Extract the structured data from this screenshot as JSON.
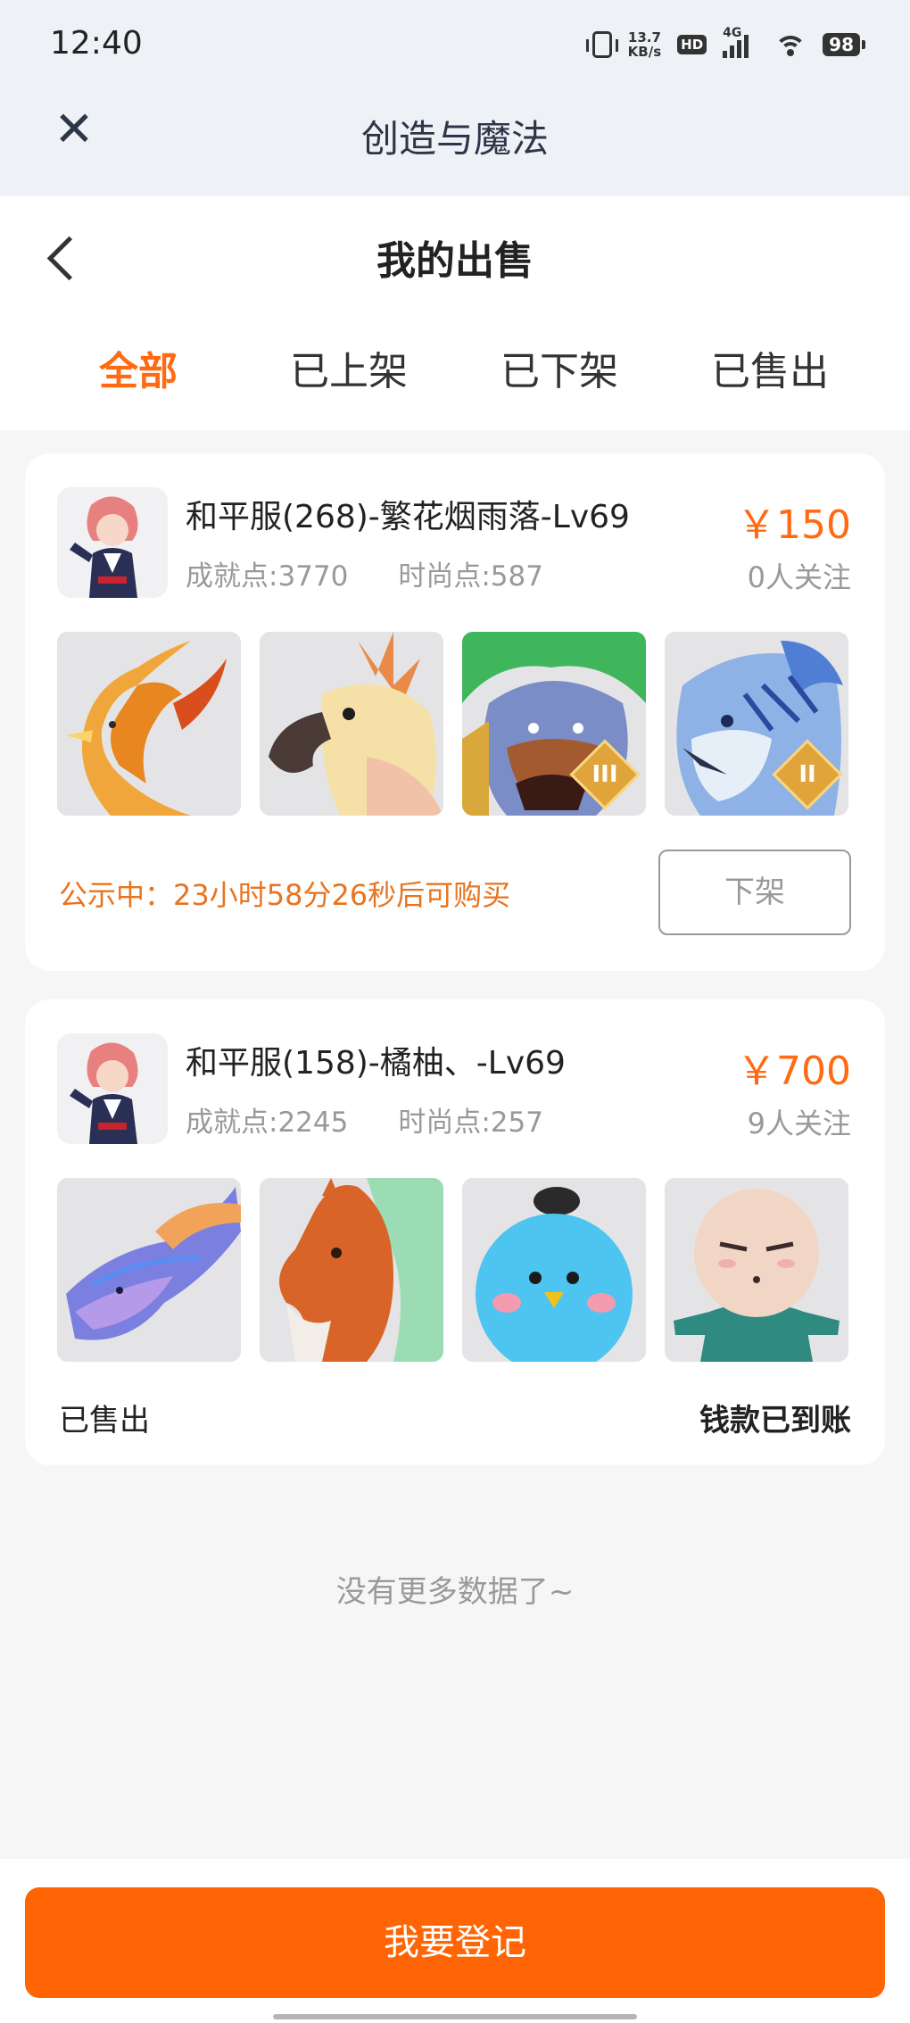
{
  "status": {
    "time": "12:40",
    "netspeed_top": "13.7",
    "netspeed_bottom": "KB/s",
    "hd": "HD",
    "network": "4G",
    "battery": "98"
  },
  "app": {
    "title": "创造与魔法"
  },
  "page": {
    "title": "我的出售"
  },
  "tabs": [
    {
      "label": "全部"
    },
    {
      "label": "已上架"
    },
    {
      "label": "已下架"
    },
    {
      "label": "已售出"
    }
  ],
  "listings": [
    {
      "server_name": "和平服(268)-繁花烟雨落-Lv69",
      "achievement": "成就点:3770",
      "fashion": "时尚点:587",
      "price": "￥150",
      "followers": "0人关注",
      "items": [
        "phoenix-mount",
        "cockatoo-mount",
        "warlion-mount",
        "frost-tiger-mount"
      ],
      "ranks": [
        "",
        "",
        "III",
        "II"
      ],
      "notice": "公示中：23小时58分26秒后可购买",
      "action_label": "下架"
    },
    {
      "server_name": "和平服(158)-橘柚、-Lv69",
      "achievement": "成就点:2245",
      "fashion": "时尚点:257",
      "price": "￥700",
      "followers": "9人关注",
      "items": [
        "azure-dragon-mount",
        "fire-horse-mount",
        "blue-bird-pet",
        "bald-doll-pet"
      ],
      "status_label": "已售出",
      "payment_label": "钱款已到账"
    }
  ],
  "footer": {
    "no_more": "没有更多数据了~",
    "register_button": "我要登记"
  },
  "colors": {
    "accent": "#ff6a13",
    "button": "#ff6504",
    "notice": "#e8741f"
  }
}
